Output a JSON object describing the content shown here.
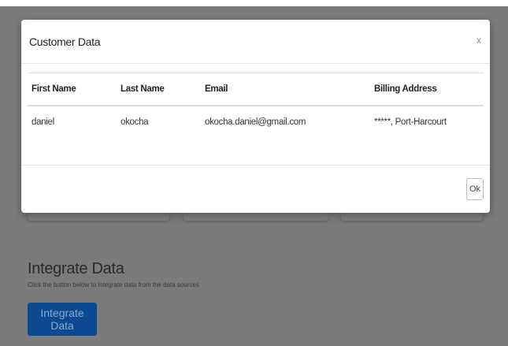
{
  "modal": {
    "title": "Customer Data",
    "close_label": "x",
    "columns": [
      "First Name",
      "Last Name",
      "Email",
      "Billing Address"
    ],
    "rows": [
      [
        "daniel",
        "okocha",
        "okocha.daniel@gmail.com",
        "*****, Port-Harcourt"
      ]
    ],
    "ok_label": "Ok"
  },
  "integrate": {
    "title": "Integrate Data",
    "subtitle": "Click the button below to integrate data from the data sources",
    "button_label": "Integrate Data"
  },
  "colors": {
    "overlay": "#7b7b7b",
    "integrate_button": "#0b4a90"
  }
}
